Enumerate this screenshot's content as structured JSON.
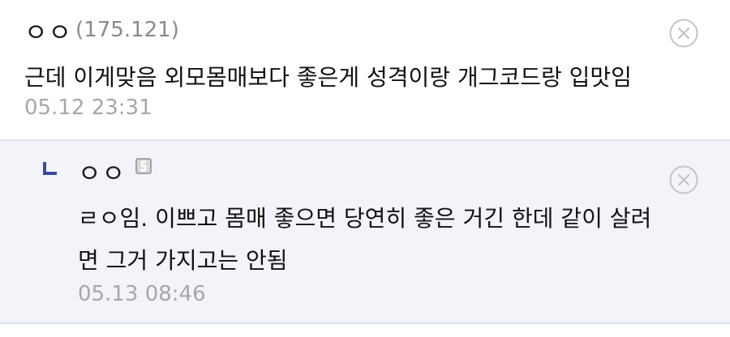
{
  "comments": [
    {
      "nickname": "ㅇㅇ",
      "ip": "(175.121)",
      "body": "근데 이게맞음 외모몸매보다 좋은게 성격이랑 개그코드랑 입맛임",
      "date": "05.12 23:31",
      "delete_icon": "circle-x-icon"
    }
  ],
  "reply": {
    "reply_icon": "reply-arrow-icon",
    "nickname": "ㅇㅇ",
    "member_icon": "fixed-member-icon",
    "body_lines": [
      "ㄹㅇ임. 이쁘고 몸매 좋으면 당연히 좋은 거긴 한데 같이 살려",
      "면 그거 가지고는 안됨"
    ],
    "date": "05.13 08:46",
    "delete_icon": "circle-x-icon"
  },
  "colors": {
    "reply_background": "#f3f4fa",
    "divider": "#dfe1ea",
    "reply_arrow": "#3b4a9c",
    "meta_text": "#a7a7a7"
  }
}
